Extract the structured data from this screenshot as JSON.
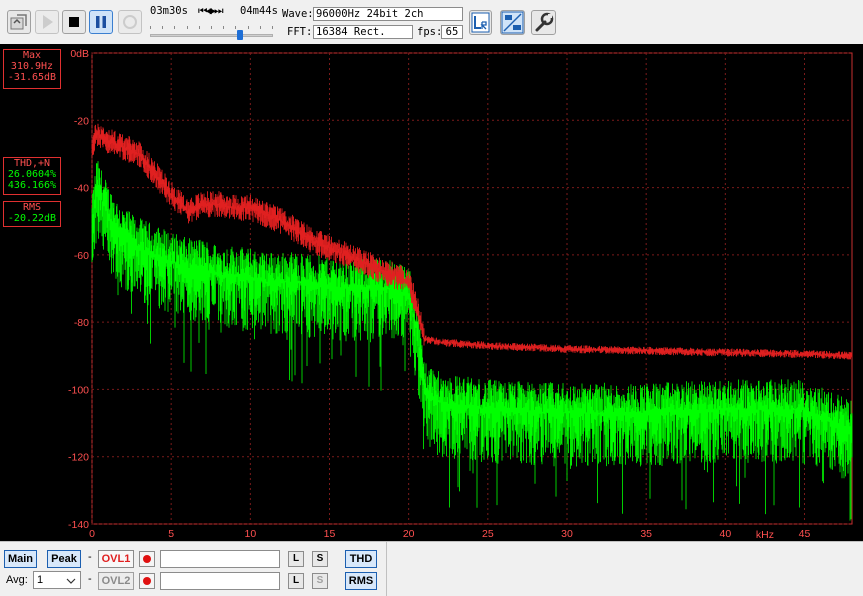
{
  "toolbar": {
    "elapsed": "03m30s",
    "remaining": "04m44s",
    "transport_glyph": "⏮◀▶⏭",
    "wave_label": "Wave:",
    "wave_value": "96000Hz 24bit 2ch",
    "fft_label": "FFT:",
    "fft_value": "16384 Rect.",
    "fps_label": "fps:",
    "fps_value": "65",
    "playback_progress": 0.74,
    "buttons": [
      "open-file",
      "play",
      "stop",
      "pause",
      "record",
      "lr-channel",
      "hz-db-scale",
      "settings"
    ]
  },
  "readouts": {
    "max_label": "Max",
    "max_freq": "310.9Hz",
    "max_level": "-31.65dB",
    "thd_label": "THD,+N",
    "thd_percent": "26.0604%",
    "thdn_percent": "436.166%",
    "rms_label": "RMS",
    "rms_value": "-20.22dB"
  },
  "chart_data": {
    "type": "line",
    "xlabel": "kHz",
    "ylabel": "",
    "xlim": [
      0,
      48
    ],
    "ylim": [
      -140,
      0
    ],
    "x_ticks": [
      0,
      5,
      10,
      15,
      20,
      25,
      30,
      35,
      40,
      45
    ],
    "y_ticks": [
      0,
      -20,
      -40,
      -60,
      -80,
      -100,
      -120,
      -140
    ],
    "y_tick_labels": [
      "0dB",
      "-20",
      "-40",
      "-60",
      "-80",
      "-100",
      "-120",
      "-140"
    ],
    "grid": true,
    "colors": {
      "peak": "#e02020",
      "spectrum": "#00ff00",
      "grid": "#7a1a1a",
      "frame": "#c83030"
    },
    "series": [
      {
        "id": "peak",
        "x": [
          0,
          0.3,
          1,
          2,
          3,
          4,
          5,
          6,
          7,
          8,
          9,
          10,
          11,
          12,
          13,
          14,
          15,
          16,
          17,
          18,
          19,
          20,
          20.5,
          21,
          22,
          25,
          30,
          35,
          40,
          45,
          48
        ],
        "y": [
          -28,
          -24,
          -26,
          -28,
          -30,
          -36,
          -42,
          -47,
          -45,
          -45,
          -46,
          -46,
          -48,
          -50,
          -53,
          -56,
          -58,
          -60,
          -62,
          -64,
          -66,
          -68,
          -75,
          -85,
          -86,
          -87,
          -88,
          -88.5,
          -89,
          -89.5,
          -90
        ]
      },
      {
        "id": "spectrum",
        "x": [
          0,
          0.3,
          1,
          2,
          3,
          4,
          5,
          6,
          7,
          8,
          9,
          10,
          11,
          12,
          13,
          14,
          15,
          16,
          17,
          18,
          19,
          20,
          20.5,
          21,
          22,
          25,
          30,
          35,
          40,
          45,
          48
        ],
        "y": [
          -52,
          -40,
          -48,
          -55,
          -58,
          -60,
          -62,
          -64,
          -64,
          -66,
          -66,
          -67,
          -68,
          -68,
          -68,
          -69,
          -69,
          -70,
          -70,
          -70,
          -70,
          -72,
          -82,
          -100,
          -104,
          -106,
          -107,
          -107,
          -106,
          -106,
          -112
        ]
      }
    ]
  },
  "bottom": {
    "main_label": "Main",
    "peak_label": "Peak",
    "dash": "-",
    "ovl1_label": "OVL1",
    "ovl2_label": "OVL2",
    "l_label": "L",
    "s_label": "S",
    "thd_label": "THD",
    "rms_label": "RMS",
    "avg_label": "Avg:",
    "avg_value": "1"
  }
}
